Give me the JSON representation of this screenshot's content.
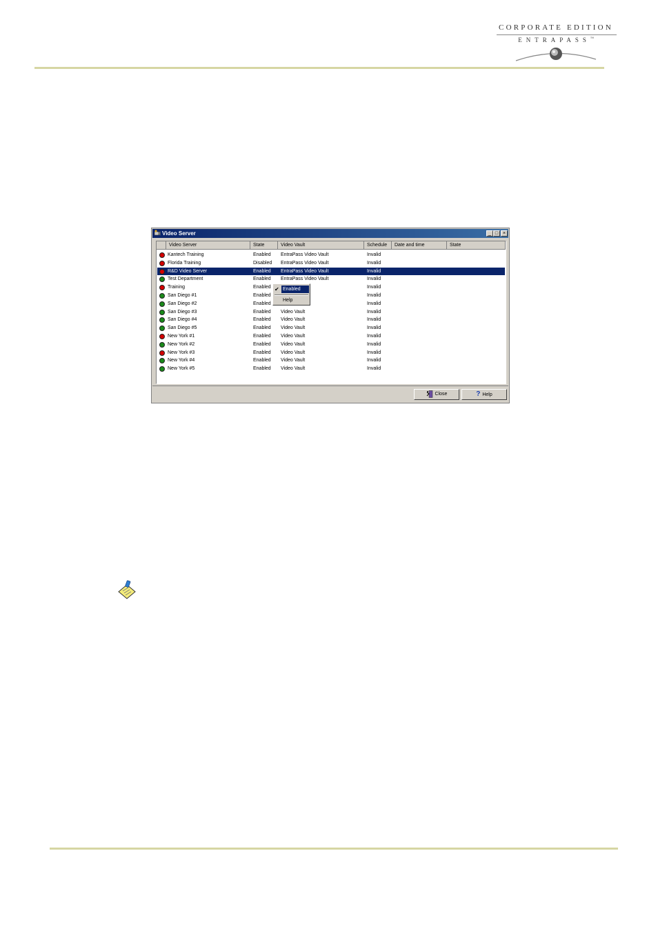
{
  "header": {
    "logo_line1": "CORPORATE EDITION",
    "logo_line2": "ENTRAPASS",
    "logo_tm": "™"
  },
  "window": {
    "title": "Video Server",
    "controls": {
      "minimize": "_",
      "maximize": "□",
      "close": "×"
    },
    "columns": [
      "Video Server",
      "State",
      "Video Vault",
      "Schedule",
      "Date and time",
      "State"
    ],
    "rows": [
      {
        "name": "Kantech Training",
        "state": "Enabled",
        "vault": "EntraPass Video Vault",
        "schedule": "Invalid",
        "status_color": "#d40000",
        "selected": false
      },
      {
        "name": "Florida Training",
        "state": "Disabled",
        "vault": "EntraPass Video Vault",
        "schedule": "Invalid",
        "status_color": "#d40000",
        "selected": false
      },
      {
        "name": "R&D Video Server",
        "state": "Enabled",
        "vault": "EntraPass Video Vault",
        "schedule": "Invalid",
        "status_color": "#d40000",
        "selected": true
      },
      {
        "name": "Test Department",
        "state": "Enabled",
        "vault": "EntraPass Video Vault",
        "schedule": "Invalid",
        "status_color": "#1a8a1a",
        "selected": false
      },
      {
        "name": "Training",
        "state": "Enabled",
        "vault": "",
        "schedule": "Invalid",
        "status_color": "#d40000",
        "selected": false
      },
      {
        "name": "San Diego #1",
        "state": "Enabled",
        "vault": "Video Vault",
        "schedule": "Invalid",
        "status_color": "#1a8a1a",
        "selected": false
      },
      {
        "name": "San Diego #2",
        "state": "Enabled",
        "vault": "Video Vault",
        "schedule": "Invalid",
        "status_color": "#1a8a1a",
        "selected": false
      },
      {
        "name": "San Diego #3",
        "state": "Enabled",
        "vault": "Video Vault",
        "schedule": "Invalid",
        "status_color": "#1a8a1a",
        "selected": false
      },
      {
        "name": "San Diego #4",
        "state": "Enabled",
        "vault": "Video Vault",
        "schedule": "Invalid",
        "status_color": "#1a8a1a",
        "selected": false
      },
      {
        "name": "San Diego #5",
        "state": "Enabled",
        "vault": "Video Vault",
        "schedule": "Invalid",
        "status_color": "#1a8a1a",
        "selected": false
      },
      {
        "name": "New York #1",
        "state": "Enabled",
        "vault": "Video Vault",
        "schedule": "Invalid",
        "status_color": "#d40000",
        "selected": false
      },
      {
        "name": "New York #2",
        "state": "Enabled",
        "vault": "Video Vault",
        "schedule": "Invalid",
        "status_color": "#1a8a1a",
        "selected": false
      },
      {
        "name": "New York #3",
        "state": "Enabled",
        "vault": "Video Vault",
        "schedule": "Invalid",
        "status_color": "#d40000",
        "selected": false
      },
      {
        "name": "New York #4",
        "state": "Enabled",
        "vault": "Video Vault",
        "schedule": "Invalid",
        "status_color": "#1a8a1a",
        "selected": false
      },
      {
        "name": "New York #5",
        "state": "Enabled",
        "vault": "Video Vault",
        "schedule": "Invalid",
        "status_color": "#1a8a1a",
        "selected": false
      }
    ],
    "context_menu": {
      "check": "✔",
      "item_enabled": "Enabled",
      "item_help": "Help"
    },
    "buttons": {
      "close": "Close",
      "help": "Help",
      "help_glyph": "?"
    }
  },
  "colors": {
    "titlebar": "#0a246a",
    "selection": "#0a246a",
    "window_face": "#d4d0c8",
    "rule": "#d6d6a3",
    "status_red": "#d40000",
    "status_green": "#1a8a1a"
  },
  "icons": {
    "window_icon": "video-server-icon",
    "close_icon": "door-exit-icon",
    "help_icon": "question-mark-icon",
    "note_icon": "notepad-note-icon"
  }
}
